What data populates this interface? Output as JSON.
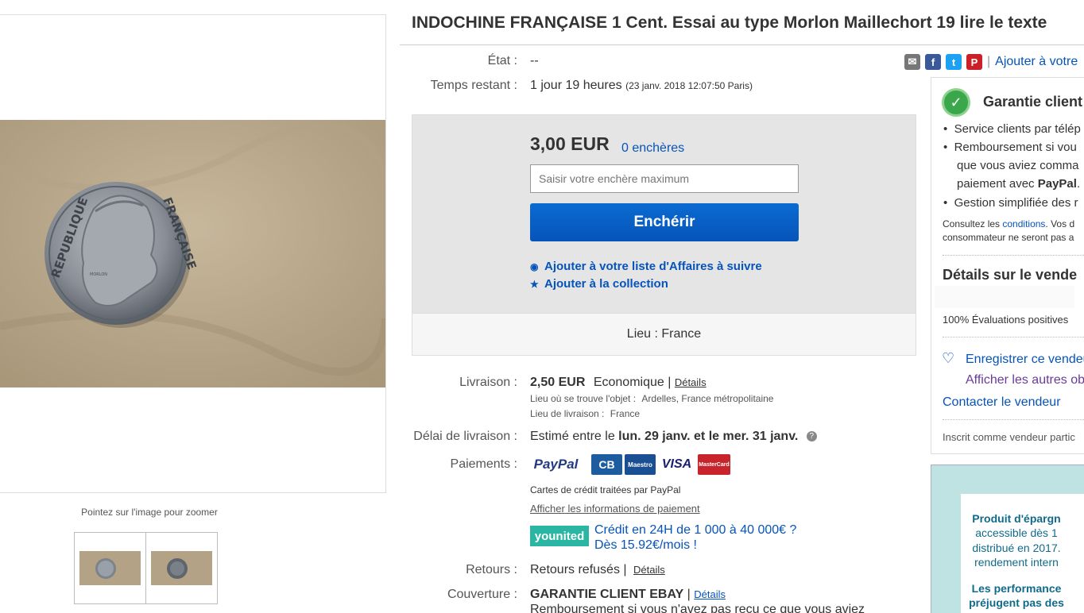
{
  "title": "INDOCHINE FRANÇAISE 1 Cent. Essai au type Morlon Maillechort 19 lire le texte",
  "gallery": {
    "zoom_hint": "Pointez sur l'image pour zoomer",
    "coin_top_text": "REPUBLIQUE",
    "coin_right_text": "FRANÇAISE",
    "coin_signature": "MORLON"
  },
  "details": {
    "etat_label": "État :",
    "etat_value": "--",
    "temps_label": "Temps restant :",
    "temps_value": "1 jour 19 heures",
    "temps_date": "(23 janv. 2018   12:07:50 Paris)"
  },
  "share": {
    "watch_link": "Ajouter à votre",
    "icons": [
      "email-icon",
      "facebook-icon",
      "twitter-icon",
      "pinterest-icon"
    ],
    "separator": "|"
  },
  "bid": {
    "price": "3,00 EUR",
    "bids": "0 enchères",
    "input_placeholder": "Saisir votre enchère maximum",
    "button": "Enchérir",
    "watch_link": "Ajouter à votre liste d'Affaires à suivre",
    "collection_link": "Ajouter à la collection",
    "location": "Lieu : France"
  },
  "shipping": {
    "label": "Livraison :",
    "price": "2,50 EUR",
    "method": "Economique |",
    "details_link": "Détails",
    "item_location_label": "Lieu où se trouve l'objet :",
    "item_location": "Ardelles, France métropolitaine",
    "ship_to_label": "Lieu de livraison :",
    "ship_to": "France"
  },
  "delivery": {
    "label": "Délai de livraison :",
    "prefix": "Estimé entre le",
    "dates": "lun. 29 janv. et le mer. 31 janv."
  },
  "payments": {
    "label": "Paiements :",
    "paypal": "PayPal",
    "cb": "CB",
    "maestro": "Maestro",
    "visa": "VISA",
    "mastercard": "MasterCard",
    "cards_note": "Cartes de crédit traitées par PayPal",
    "info_link": "Afficher les informations de paiement",
    "younited": "younited",
    "credit_line1": "Crédit en 24H de 1 000 à 40 000€ ?",
    "credit_line2": "Dès 15.92€/mois !"
  },
  "returns": {
    "label": "Retours :",
    "value": "Retours refusés |",
    "details_link": "Détails"
  },
  "coverage": {
    "label": "Couverture :",
    "value": "GARANTIE CLIENT EBAY",
    "sep": "|",
    "details_link": "Détails",
    "line2": "Remboursement si vous n'avez pas reçu ce que vous aviez"
  },
  "guarantee": {
    "title": "Garantie client",
    "bullet1": "Service clients par télép",
    "bullet2a": "Remboursement si vou",
    "bullet2b": "que vous aviez comma",
    "bullet2c_prefix": "paiement avec ",
    "bullet2c_bold": "PayPal",
    "bullet2c_suffix": ".",
    "bullet3": "Gestion simplifiée des r",
    "note1_prefix": "Consultez les ",
    "note1_link": "conditions",
    "note1_suffix": ". Vos d",
    "note2": "consommateur ne seront pas a",
    "seller_heading": "Détails sur le vende",
    "positive": "100% Évaluations positives",
    "save_seller": "Enregistrer ce vendeu",
    "other_items": "Afficher les autres obj",
    "contact": "Contacter le vendeur",
    "registered": "Inscrit comme vendeur partic"
  },
  "ad": {
    "line1": "Produit d'épargn",
    "line2": "accessible dès 1",
    "line3": "distribué en 2017.",
    "line4": "rendement intern",
    "line5": "Les performance",
    "line6": "préjugent pas des"
  },
  "colors": {
    "link": "#0654ba",
    "button": "#0654ba",
    "bid_box": "#e5e5e5",
    "younited": "#2bb6a3"
  }
}
